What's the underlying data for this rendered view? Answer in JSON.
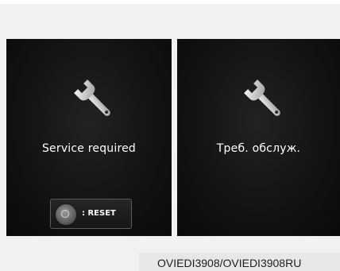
{
  "screens": [
    {
      "icon": "wrench-icon",
      "message": "Service required",
      "reset_label": ": RESET"
    },
    {
      "icon": "wrench-icon",
      "message": "Треб. обслуж."
    }
  ],
  "caption": "OVIEDI3908/OVIEDI3908RU",
  "colors": {
    "panel_background": "#111111",
    "text": "#ffffff",
    "page_background": "#f1f1f1"
  }
}
